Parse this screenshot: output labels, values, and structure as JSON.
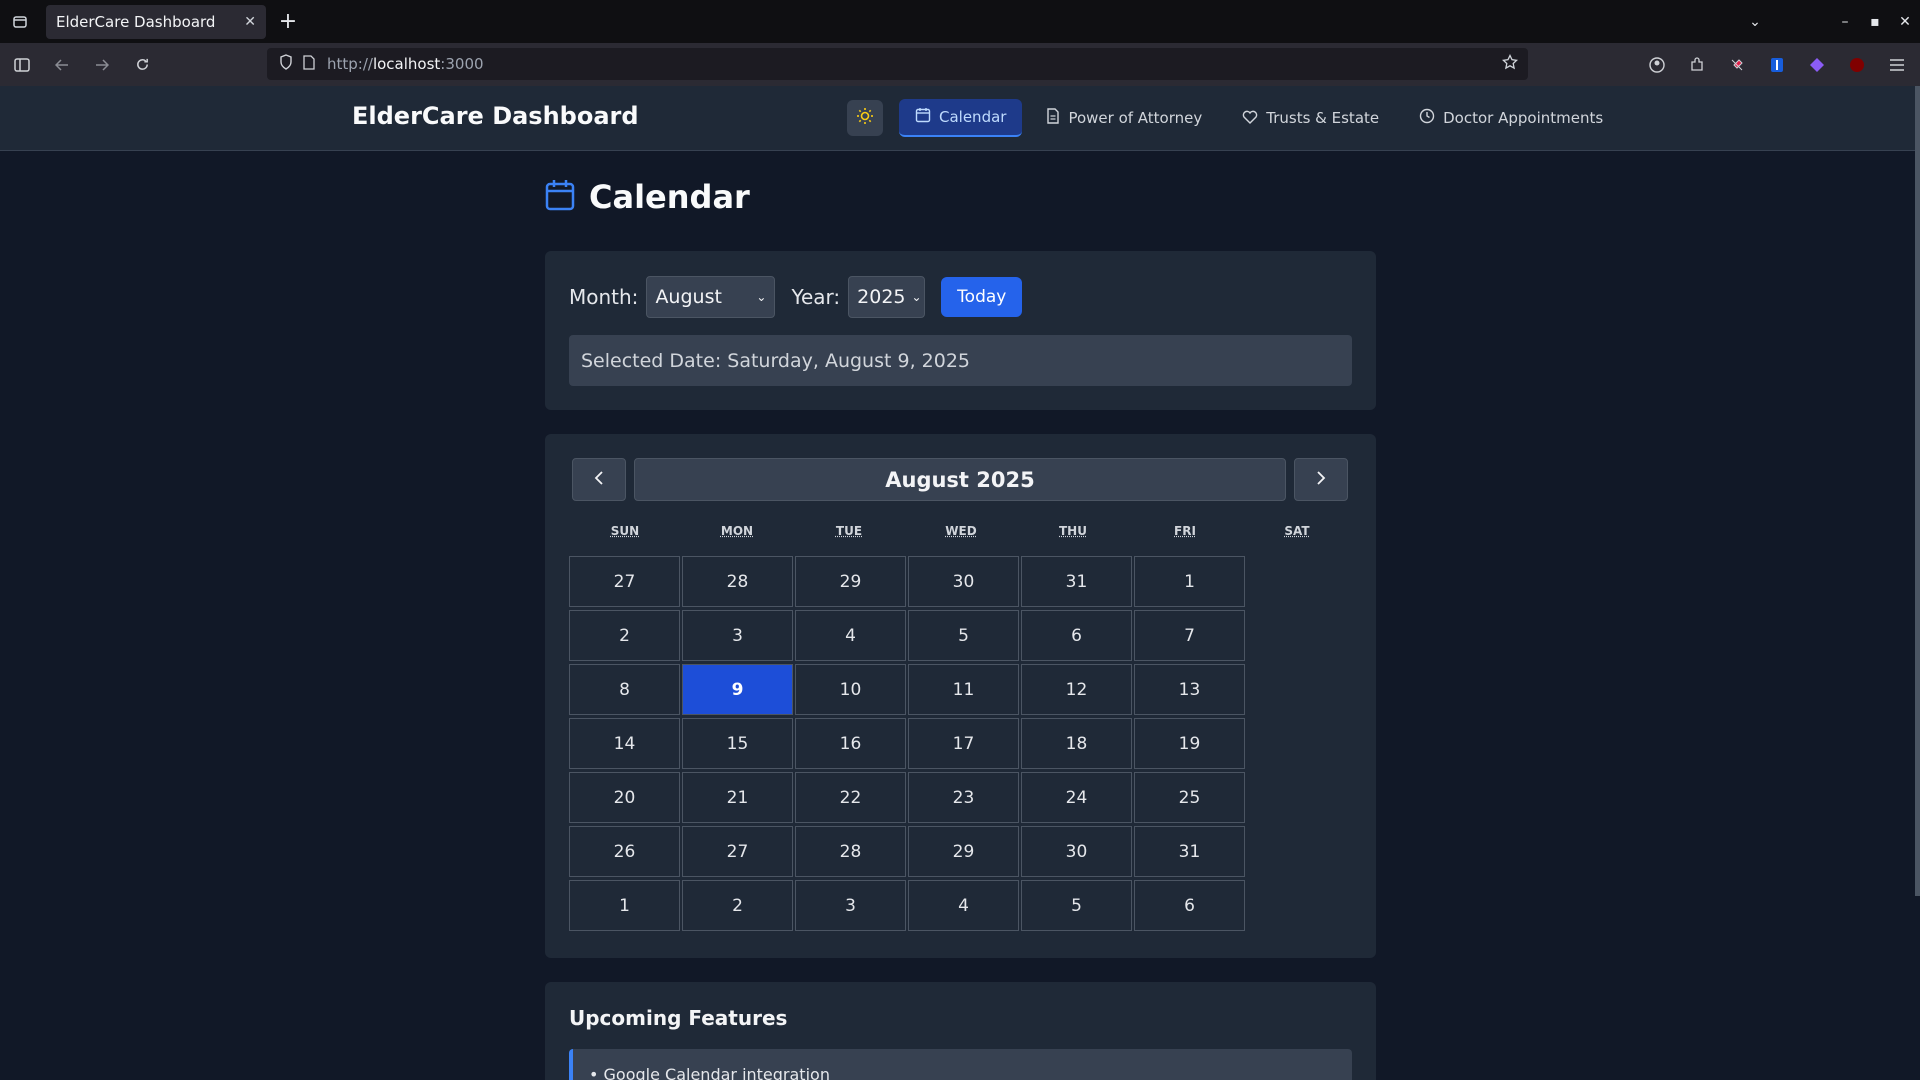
{
  "browser": {
    "tab_title": "ElderCare Dashboard",
    "tab_close": "✕",
    "new_tab": "+",
    "url_scheme": "http://",
    "url_host": "localhost",
    "url_port": ":3000"
  },
  "header": {
    "brand": "ElderCare Dashboard",
    "nav": [
      {
        "label": "Calendar",
        "icon": "calendar-icon",
        "active": true
      },
      {
        "label": "Power of Attorney",
        "icon": "document-icon",
        "active": false
      },
      {
        "label": "Trusts & Estate",
        "icon": "heart-icon",
        "active": false
      },
      {
        "label": "Doctor Appointments",
        "icon": "clock-icon",
        "active": false
      }
    ]
  },
  "page": {
    "title": "Calendar"
  },
  "controls": {
    "month_label": "Month:",
    "month_value": "August",
    "year_label": "Year:",
    "year_value": "2025",
    "today_label": "Today",
    "selected_date": "Selected Date: Saturday, August 9, 2025"
  },
  "calendar": {
    "month_title": "August 2025",
    "weekdays": [
      "SUN",
      "MON",
      "TUE",
      "WED",
      "THU",
      "FRI",
      "SAT"
    ],
    "selected_day": "9",
    "weeks": [
      [
        "27",
        "28",
        "29",
        "30",
        "31",
        "1"
      ],
      [
        "2",
        "3",
        "4",
        "5",
        "6",
        "7"
      ],
      [
        "8",
        "9",
        "10",
        "11",
        "12",
        "13"
      ],
      [
        "14",
        "15",
        "16",
        "17",
        "18",
        "19"
      ],
      [
        "20",
        "21",
        "22",
        "23",
        "24",
        "25"
      ],
      [
        "26",
        "27",
        "28",
        "29",
        "30",
        "31"
      ],
      [
        "1",
        "2",
        "3",
        "4",
        "5",
        "6"
      ]
    ]
  },
  "upcoming": {
    "title": "Upcoming Features",
    "items": [
      "• Google Calendar integration"
    ]
  },
  "colors": {
    "accent": "#2563eb",
    "background": "#111827",
    "card": "#1f2937"
  }
}
